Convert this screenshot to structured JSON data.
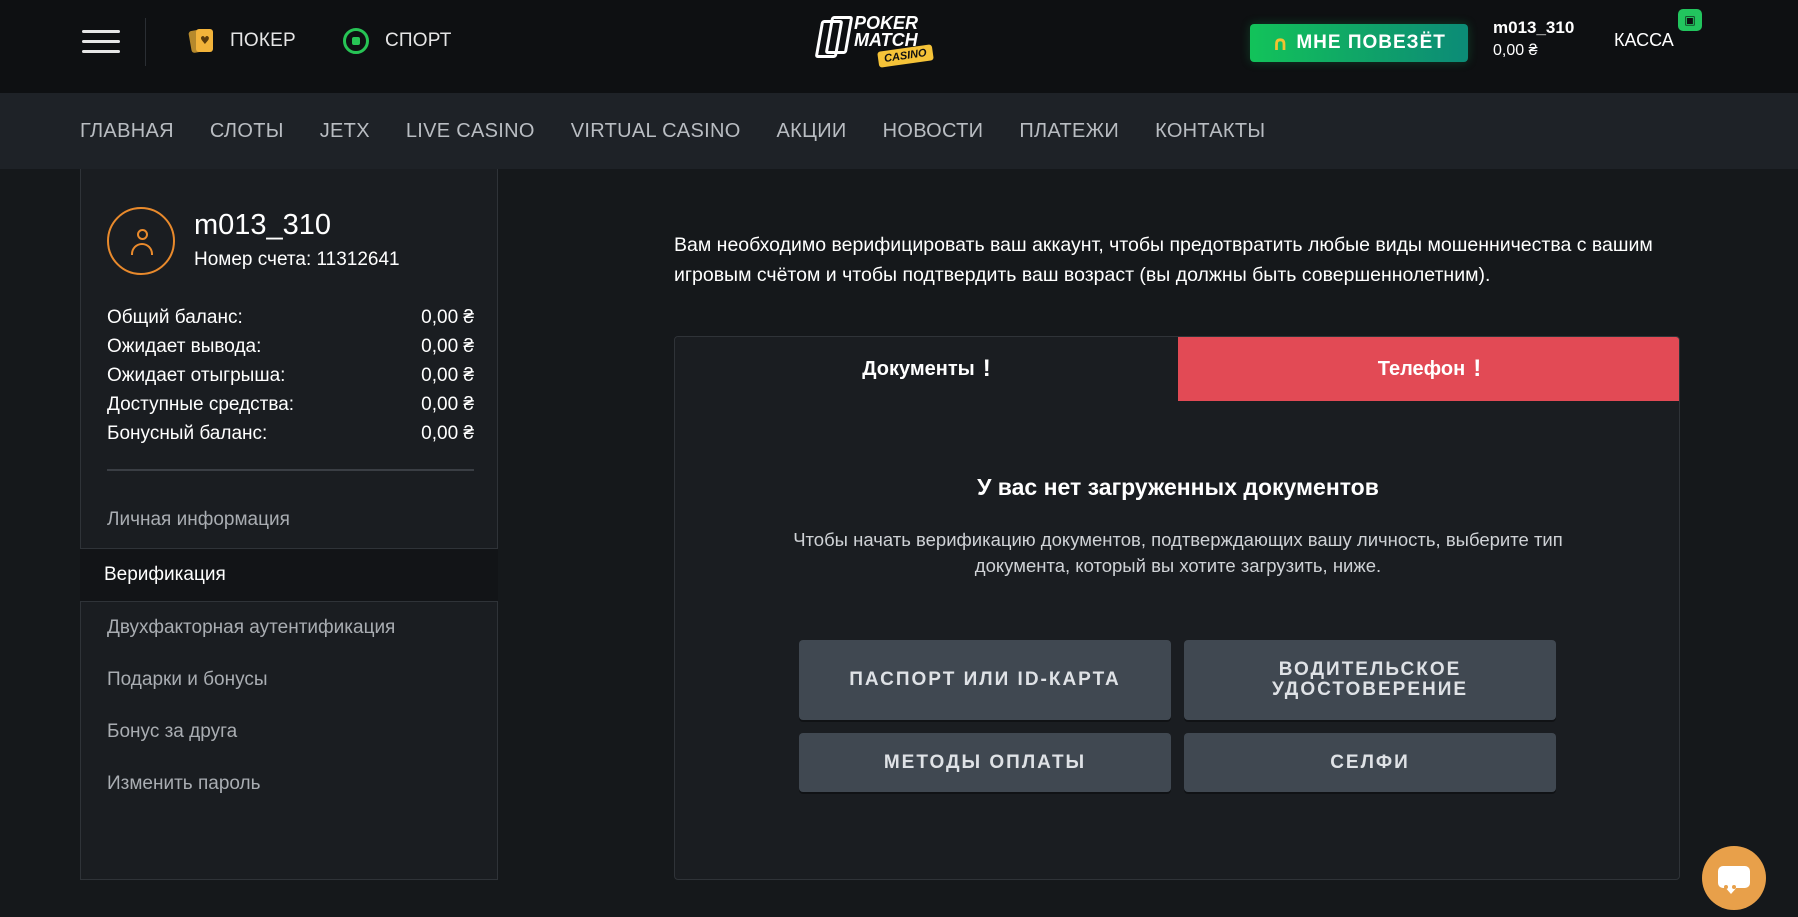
{
  "header": {
    "menu_icon": "hamburger-icon",
    "nav": [
      {
        "label": "ПОКЕР",
        "icon": "poker-cards-icon"
      },
      {
        "label": "СПОРТ",
        "icon": "soccer-ball-icon"
      }
    ],
    "logo": {
      "line1": "POKER",
      "line2": "MATCH",
      "badge": "CASINO"
    },
    "lucky_button": {
      "label": "МНЕ ПОВЕЗЁТ",
      "icon": "horseshoe-icon"
    },
    "user": {
      "name": "m013_310",
      "balance": "0,00 ₴"
    },
    "cashier_label": "КАССА",
    "gift_icon": "gift-icon",
    "colors": {
      "accent_green": "#12c35a",
      "gold": "#f5c338"
    }
  },
  "main_nav": [
    "ГЛАВНАЯ",
    "СЛОТЫ",
    "JETX",
    "LIVE CASINO",
    "VIRTUAL CASINO",
    "АКЦИИ",
    "НОВОСТИ",
    "ПЛАТЕЖИ",
    "КОНТАКТЫ"
  ],
  "profile": {
    "avatar_icon": "user-icon",
    "username": "m013_310",
    "account_number": "Номер счета: 11312641",
    "balances": [
      {
        "label": "Общий баланс:",
        "value": "0,00 ₴"
      },
      {
        "label": "Ожидает вывода:",
        "value": "0,00 ₴"
      },
      {
        "label": "Ожидает отыгрыша:",
        "value": "0,00 ₴"
      },
      {
        "label": "Доступные средства:",
        "value": "0,00 ₴"
      },
      {
        "label": "Бонусный баланс:",
        "value": "0,00 ₴"
      }
    ],
    "menu": {
      "personal_info": "Личная информация",
      "verification": "Верификация",
      "two_factor": "Двухфакторная аутентификация",
      "gifts_bonuses": "Подарки и бонусы",
      "friend_bonus": "Бонус за друга",
      "change_password": "Изменить пароль"
    },
    "accent_color": "#e98a2c"
  },
  "verification": {
    "intro": "Вам необходимо верифицировать ваш аккаунт, чтобы предотвратить любые виды мошенничества с вашим игровым счётом и чтобы подтвердить ваш возраст (вы должны быть совершеннолетним).",
    "tabs": [
      {
        "label": "Документы",
        "warning": "!"
      },
      {
        "label": "Телефон",
        "warning": "!"
      }
    ],
    "active_tab": "Документы",
    "empty_title": "У вас нет загруженных документов",
    "empty_subtitle": "Чтобы начать верификацию документов, подтверждающих вашу личность, выберите тип документа, который вы хотите загрузить, ниже.",
    "doc_types": [
      "ПАСПОРТ ИЛИ ID-КАРТА",
      "ВОДИТЕЛЬСКОЕ УДОСТОВЕРЕНИЕ",
      "МЕТОДЫ ОПЛАТЫ",
      "СЕЛФИ"
    ],
    "phone_tab_color": "#e24a55"
  },
  "chat": {
    "icon": "chat-bubble-icon",
    "color": "#e8a04a"
  }
}
